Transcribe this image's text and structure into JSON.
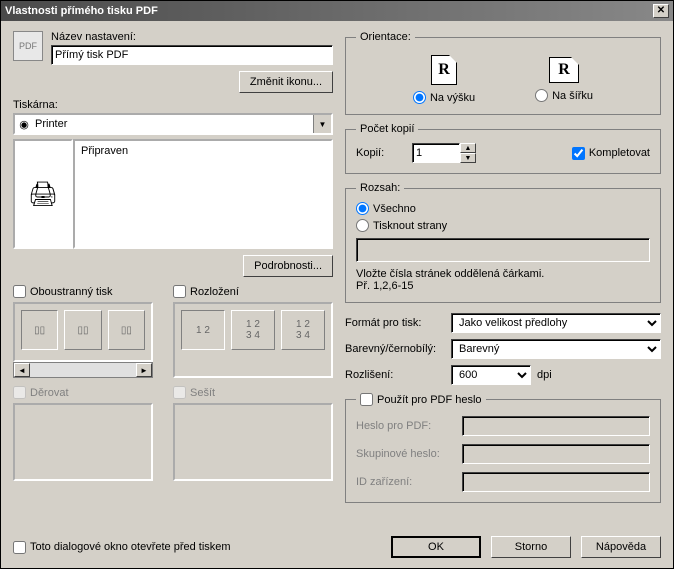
{
  "window": {
    "title": "Vlastnosti přímého tisku PDF"
  },
  "left": {
    "settings_name_label": "Název nastavení:",
    "settings_name_value": "Přímý tisk PDF",
    "change_icon_btn": "Změnit ikonu...",
    "printer_label": "Tiskárna:",
    "printer_value": "Printer",
    "printer_status": "Připraven",
    "details_btn": "Podrobnosti...",
    "duplex_label": "Oboustranný tisk",
    "layout_label": "Rozložení",
    "punch_label": "Děrovat",
    "staple_label": "Sešít"
  },
  "orientation": {
    "legend": "Orientace:",
    "portrait_label": "Na výšku",
    "landscape_label": "Na šířku",
    "glyph": "R"
  },
  "copies": {
    "legend": "Počet kopií",
    "copies_label": "Kopií:",
    "copies_value": "1",
    "collate_label": "Kompletovat"
  },
  "range": {
    "legend": "Rozsah:",
    "all_label": "Všechno",
    "pages_label": "Tisknout strany",
    "pages_value": "",
    "hint1": "Vložte čísla stránek oddělená čárkami.",
    "hint2": "Př. 1,2,6-15"
  },
  "format": {
    "print_format_label": "Formát pro tisk:",
    "print_format_value": "Jako velikost předlohy",
    "color_label": "Barevný/černobílý:",
    "color_value": "Barevný",
    "resolution_label": "Rozlišení:",
    "resolution_value": "600",
    "resolution_unit": "dpi"
  },
  "pdfpass": {
    "legend": "Použít pro PDF heslo",
    "pdf_pw_label": "Heslo pro PDF:",
    "group_pw_label": "Skupinové heslo:",
    "device_id_label": "ID zařízení:"
  },
  "footer": {
    "open_before_print": "Toto dialogové okno otevřete před tiskem",
    "ok": "OK",
    "cancel": "Storno",
    "help": "Nápověda"
  }
}
